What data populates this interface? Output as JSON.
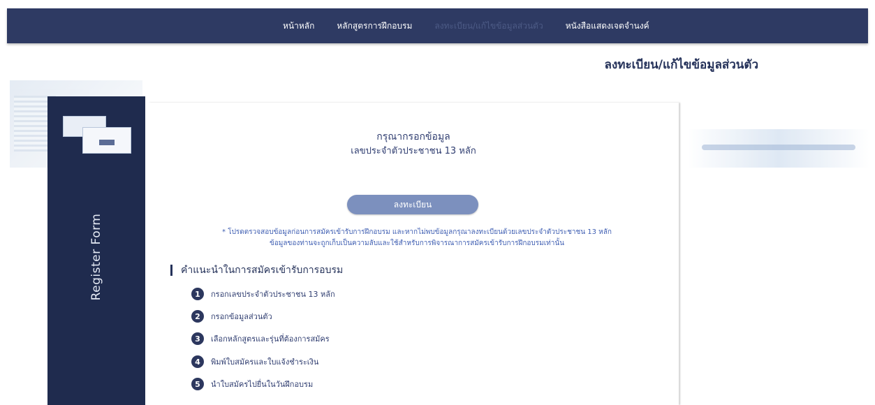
{
  "nav": {
    "items": [
      {
        "label": "หน้าหลัก",
        "dim": false
      },
      {
        "label": "หลักสูตรการฝึกอบรม",
        "dim": false
      },
      {
        "label": "ลงทะเบียน/แก้ไขข้อมูลส่วนตัว",
        "dim": true
      },
      {
        "label": "หนังสือแสดงเจตจำนงค์",
        "dim": false
      }
    ]
  },
  "page": {
    "title": "ลงทะเบียน/แก้ไขข้อมูลส่วนตัว"
  },
  "sidebar": {
    "vertical_label": "Register Form"
  },
  "form": {
    "title": "กรุณากรอกข้อมูล",
    "subtitle": "เลขประจำตัวประชาชน 13 หลัก",
    "register_button": "ลงทะเบียน",
    "note_line1": "* โปรดตรวจสอบข้อมูลก่อนการสมัครเข้ารับการฝึกอบรม และหากไม่พบข้อมูลกรุณาลงทะเบียนด้วยเลขประจำตัวประชาชน 13 หลัก",
    "note_line2": "ข้อมูลของท่านจะถูกเก็บเป็นความลับและใช้สำหรับการพิจารณาการสมัครเข้ารับการฝึกอบรมเท่านั้น"
  },
  "instructions": {
    "heading": "คำแนะนำในการสมัครเข้ารับการอบรม",
    "steps": [
      {
        "num": "1",
        "label": "กรอกเลขประจำตัวประชาชน 13 หลัก"
      },
      {
        "num": "2",
        "label": "กรอกข้อมูลส่วนตัว"
      },
      {
        "num": "3",
        "label": "เลือกหลักสูตรและรุ่นที่ต้องการสมัคร"
      },
      {
        "num": "4",
        "label": "พิมพ์ใบสมัครและใบแจ้งชำระเงิน"
      },
      {
        "num": "5",
        "label": "นำใบสมัครไปยื่นในวันฝึกอบรม"
      }
    ]
  },
  "colors": {
    "topbar": "#2e3a63",
    "sidebar": "#1f2b4e",
    "button": "#7c90be",
    "note_text": "#4160b3"
  }
}
